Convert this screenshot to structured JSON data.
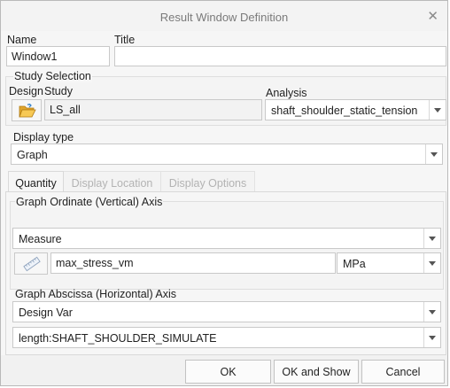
{
  "window": {
    "title": "Result Window Definition",
    "close_glyph": "✕"
  },
  "name": {
    "label": "Name",
    "value": "Window1"
  },
  "title_field": {
    "label": "Title",
    "value": ""
  },
  "study_selection": {
    "legend": "Study Selection",
    "design_label": "Design",
    "study_label": "Study",
    "study_value": "LS_all",
    "analysis_label": "Analysis",
    "analysis_value": "shaft_shoulder_static_tension"
  },
  "display_type": {
    "legend": "Display type",
    "value": "Graph"
  },
  "tabs": [
    {
      "label": "Quantity",
      "active": true
    },
    {
      "label": "Display Location",
      "active": false
    },
    {
      "label": "Display Options",
      "active": false
    }
  ],
  "ordinate": {
    "legend": "Graph Ordinate (Vertical) Axis",
    "type_value": "Measure",
    "measure_value": "max_stress_vm",
    "unit_value": "MPa"
  },
  "abscissa": {
    "legend": "Graph Abscissa (Horizontal) Axis",
    "type_value": "Design Var",
    "var_value": "length:SHAFT_SHOULDER_SIMULATE"
  },
  "buttons": {
    "ok": "OK",
    "ok_show": "OK and Show",
    "cancel": "Cancel"
  }
}
